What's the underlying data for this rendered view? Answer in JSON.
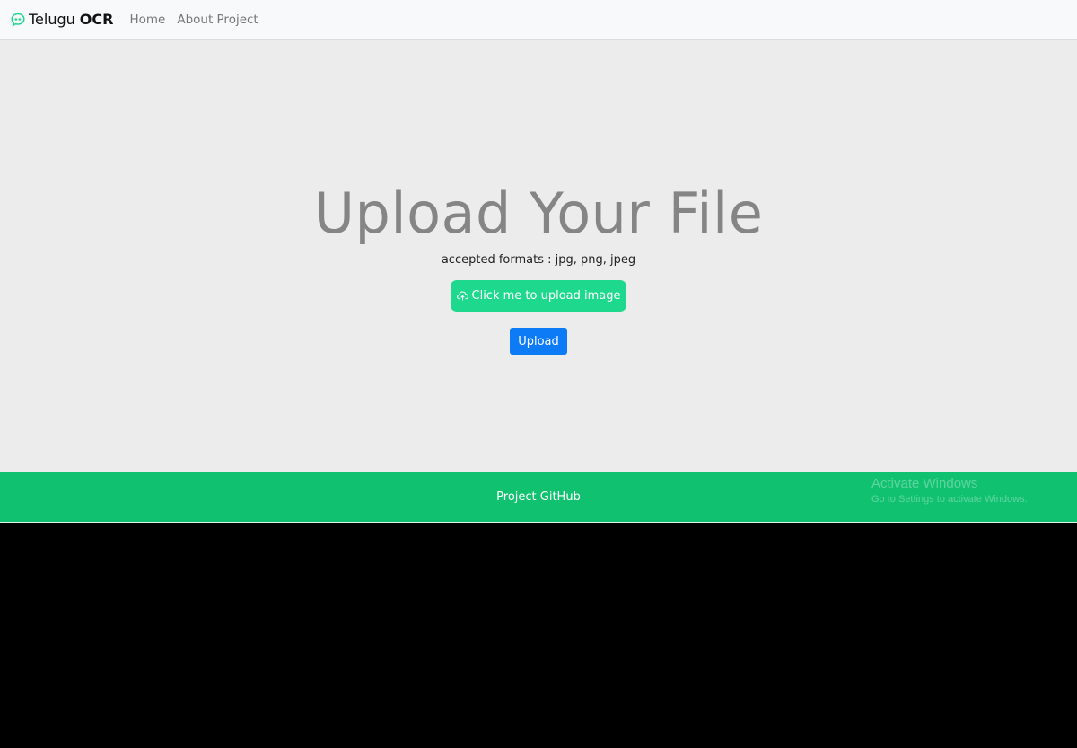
{
  "navbar": {
    "brand": {
      "prefix": "Telugu",
      "suffix": "OCR",
      "logo_icon": "speech-quote-icon",
      "logo_color": "#1ed98d"
    },
    "links": [
      {
        "label": "Home"
      },
      {
        "label": "About Project"
      }
    ]
  },
  "main": {
    "title": "Upload Your File",
    "formats_text": "accepted formats : jpg, png, jpeg",
    "choose_button": {
      "label": "Click me to upload image",
      "icon": "cloud-upload-icon",
      "color": "#1ed98d"
    },
    "upload_button": {
      "label": "Upload",
      "color": "#0c7bf5"
    }
  },
  "footer": {
    "link": "Project GitHub",
    "color": "#10c170",
    "watermark": {
      "title": "Activate Windows",
      "subtitle": "Go to Settings to activate Windows."
    }
  }
}
